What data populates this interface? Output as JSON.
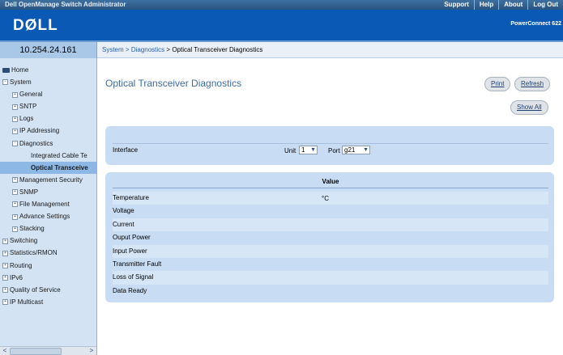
{
  "app": {
    "title": "Dell OpenManage Switch Administrator",
    "top_links": [
      "Support",
      "Help",
      "About",
      "Log Out"
    ],
    "logo": "DØLL",
    "product": "PowerConnect 622"
  },
  "device_ip": "10.254.24.161",
  "breadcrumb": {
    "system": "System",
    "sep1": ">",
    "diagnostics": "Diagnostics",
    "sep2": ">",
    "current": "Optical Transceiver Diagnostics"
  },
  "sidebar": {
    "items": [
      {
        "label": "Home",
        "level": 0,
        "icon": "folder-icon"
      },
      {
        "label": "System",
        "level": 0,
        "expander": "-"
      },
      {
        "label": "General",
        "level": 1,
        "expander": "+"
      },
      {
        "label": "SNTP",
        "level": 1,
        "expander": "+"
      },
      {
        "label": "Logs",
        "level": 1,
        "expander": "+"
      },
      {
        "label": "IP Addressing",
        "level": 1,
        "expander": "+"
      },
      {
        "label": "Diagnostics",
        "level": 1,
        "expander": "-"
      },
      {
        "label": "Integrated Cable Te",
        "level": 2
      },
      {
        "label": "Optical Transceive",
        "level": 2,
        "selected": true
      },
      {
        "label": "Management Security",
        "level": 1,
        "expander": "+"
      },
      {
        "label": "SNMP",
        "level": 1,
        "expander": "+"
      },
      {
        "label": "File Management",
        "level": 1,
        "expander": "+"
      },
      {
        "label": "Advance Settings",
        "level": 1,
        "expander": "+"
      },
      {
        "label": "Stacking",
        "level": 1,
        "expander": "+"
      },
      {
        "label": "Switching",
        "level": 0,
        "expander": "+"
      },
      {
        "label": "Statistics/RMON",
        "level": 0,
        "expander": "+"
      },
      {
        "label": "Routing",
        "level": 0,
        "expander": "+"
      },
      {
        "label": "IPv6",
        "level": 0,
        "expander": "+"
      },
      {
        "label": "Quality of Service",
        "level": 0,
        "expander": "+"
      },
      {
        "label": "IP Multicast",
        "level": 0,
        "expander": "+"
      }
    ],
    "scroll_left": "<",
    "scroll_right": ">"
  },
  "main": {
    "title": "Optical Transceiver Diagnostics",
    "buttons": {
      "print": "Print",
      "refresh": "Refresh",
      "show_all": "Show All"
    },
    "interface": {
      "label": "Interface",
      "unit_label": "Unit",
      "unit_value": "1",
      "port_label": "Port",
      "port_value": "g21"
    },
    "value_table": {
      "header": "Value",
      "rows": [
        {
          "label": "Temperature",
          "unit": "°C"
        },
        {
          "label": "Voltage",
          "unit": ""
        },
        {
          "label": "Current",
          "unit": ""
        },
        {
          "label": "Ouput Power",
          "unit": ""
        },
        {
          "label": "Input Power",
          "unit": ""
        },
        {
          "label": "Transmitter Fault",
          "unit": ""
        },
        {
          "label": "Loss of Signal",
          "unit": ""
        },
        {
          "label": "Data Ready",
          "unit": ""
        }
      ]
    }
  },
  "colors": {
    "banner": "#0a59b5",
    "sidebar": "#d3e3f3",
    "panel": "#c8dcf3",
    "title": "#3e6ea8"
  }
}
